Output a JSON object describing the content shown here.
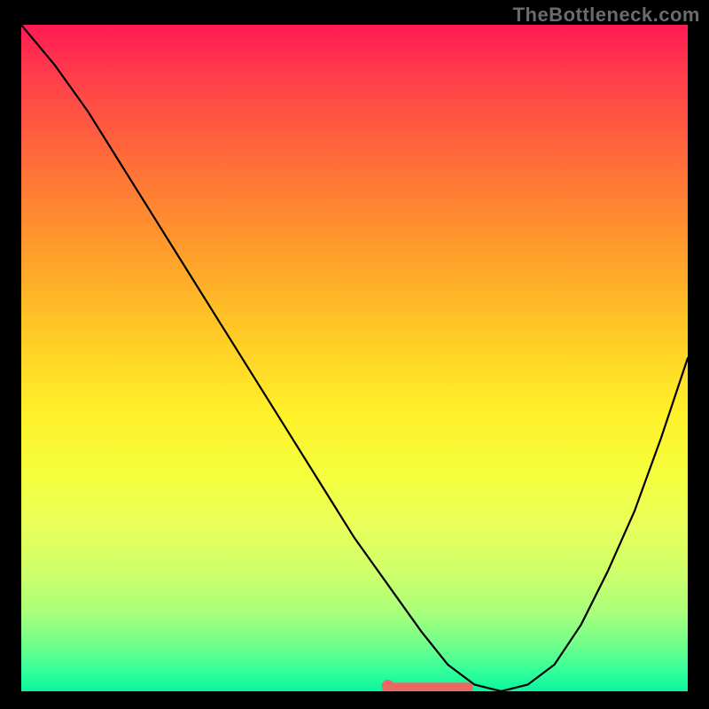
{
  "watermark": "TheBottleneck.com",
  "chart_data": {
    "type": "line",
    "title": "",
    "xlabel": "",
    "ylabel": "",
    "xlim": [
      0,
      100
    ],
    "ylim": [
      0,
      100
    ],
    "grid": false,
    "legend": false,
    "annotations": [],
    "series": [
      {
        "name": "bottleneck-curve",
        "color": "#000000",
        "x": [
          0,
          5,
          10,
          15,
          20,
          25,
          30,
          35,
          40,
          45,
          50,
          55,
          60,
          64,
          68,
          72,
          76,
          80,
          84,
          88,
          92,
          96,
          100
        ],
        "y": [
          100,
          94,
          87,
          79,
          71,
          63,
          55,
          47,
          39,
          31,
          23,
          16,
          9,
          4,
          1,
          0,
          1,
          4,
          10,
          18,
          27,
          38,
          50
        ]
      },
      {
        "name": "optimal-flat",
        "color": "#e86a63",
        "x": [
          55,
          67
        ],
        "y": [
          0.5,
          0.5
        ]
      }
    ],
    "marker": {
      "name": "marker",
      "x": 55,
      "y": 0.8,
      "color": "#e86a63"
    }
  }
}
